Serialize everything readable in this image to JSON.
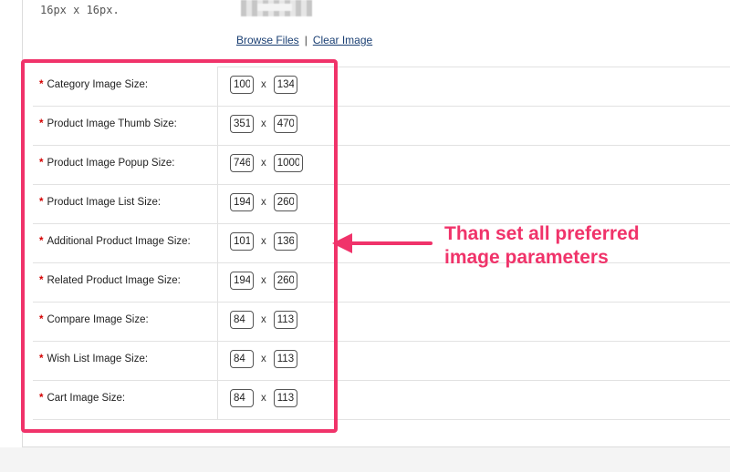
{
  "image_field": {
    "size_hint": "16px x 16px.",
    "browse_label": "Browse Files",
    "separator": "|",
    "clear_label": "Clear Image"
  },
  "rows": [
    {
      "label": "Category Image Size:",
      "width": "100",
      "height": "134"
    },
    {
      "label": "Product Image Thumb Size:",
      "width": "351",
      "height": "470"
    },
    {
      "label": "Product Image Popup Size:",
      "width": "746",
      "height": "1000"
    },
    {
      "label": "Product Image List Size:",
      "width": "194",
      "height": "260"
    },
    {
      "label": "Additional Product Image Size:",
      "width": "101",
      "height": "136"
    },
    {
      "label": "Related Product Image Size:",
      "width": "194",
      "height": "260"
    },
    {
      "label": "Compare Image Size:",
      "width": "84",
      "height": "113"
    },
    {
      "label": "Wish List Image Size:",
      "width": "84",
      "height": "113"
    },
    {
      "label": "Cart Image Size:",
      "width": "84",
      "height": "113"
    }
  ],
  "required_mark": "*",
  "times_sign": "x",
  "annotation": {
    "line1": "Than set all preferred",
    "line2": "image parameters",
    "color": "#f0336a"
  }
}
